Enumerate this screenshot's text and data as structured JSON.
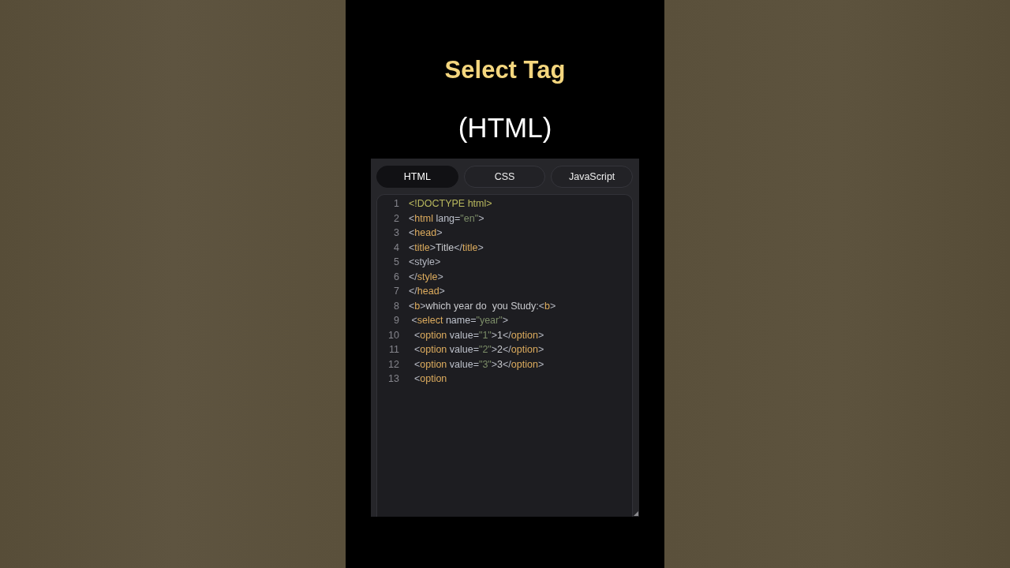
{
  "heading": {
    "title": "Select Tag",
    "subtitle": "(HTML)"
  },
  "tabs": [
    {
      "label": "HTML",
      "selected": true
    },
    {
      "label": "CSS",
      "selected": false
    },
    {
      "label": "JavaScript",
      "selected": false
    }
  ],
  "code_lines": [
    {
      "number": "1",
      "tokens": [
        {
          "kind": "doctype",
          "text": "<!DOCTYPE html>"
        }
      ]
    },
    {
      "number": "2",
      "tokens": [
        {
          "kind": "punct",
          "text": "<"
        },
        {
          "kind": "tag",
          "text": "html"
        },
        {
          "kind": "attr",
          "text": " lang="
        },
        {
          "kind": "string",
          "text": "\"en\""
        },
        {
          "kind": "punct",
          "text": ">"
        }
      ]
    },
    {
      "number": "3",
      "tokens": [
        {
          "kind": "punct",
          "text": "<"
        },
        {
          "kind": "tag",
          "text": "head"
        },
        {
          "kind": "punct",
          "text": ">"
        }
      ]
    },
    {
      "number": "4",
      "tokens": [
        {
          "kind": "punct",
          "text": "<"
        },
        {
          "kind": "tag",
          "text": "title"
        },
        {
          "kind": "punct",
          "text": ">"
        },
        {
          "kind": "text",
          "text": "Title"
        },
        {
          "kind": "punct",
          "text": "</"
        },
        {
          "kind": "tag",
          "text": "title"
        },
        {
          "kind": "punct",
          "text": ">"
        }
      ]
    },
    {
      "number": "5",
      "tokens": [
        {
          "kind": "punct",
          "text": "<style>"
        }
      ]
    },
    {
      "number": "6",
      "tokens": [
        {
          "kind": "punct",
          "text": "</"
        },
        {
          "kind": "tag",
          "text": "style"
        },
        {
          "kind": "punct",
          "text": ">"
        }
      ]
    },
    {
      "number": "7",
      "tokens": [
        {
          "kind": "punct",
          "text": "</"
        },
        {
          "kind": "tag",
          "text": "head"
        },
        {
          "kind": "punct",
          "text": ">"
        }
      ]
    },
    {
      "number": "8",
      "tokens": [
        {
          "kind": "punct",
          "text": "<"
        },
        {
          "kind": "tag",
          "text": "b"
        },
        {
          "kind": "punct",
          "text": ">"
        },
        {
          "kind": "text",
          "text": "which year do  you Study:"
        },
        {
          "kind": "punct",
          "text": "<"
        },
        {
          "kind": "tag",
          "text": "b"
        },
        {
          "kind": "punct",
          "text": ">"
        }
      ]
    },
    {
      "number": "9",
      "tokens": [
        {
          "kind": "punct",
          "text": " <"
        },
        {
          "kind": "tag",
          "text": "select"
        },
        {
          "kind": "attr",
          "text": " name="
        },
        {
          "kind": "string",
          "text": "\"year\""
        },
        {
          "kind": "punct",
          "text": ">"
        }
      ]
    },
    {
      "number": "10",
      "tokens": [
        {
          "kind": "punct",
          "text": "  <"
        },
        {
          "kind": "tag",
          "text": "option"
        },
        {
          "kind": "attr",
          "text": " value="
        },
        {
          "kind": "string",
          "text": "\"1\""
        },
        {
          "kind": "punct",
          "text": ">"
        },
        {
          "kind": "text",
          "text": "1"
        },
        {
          "kind": "punct",
          "text": "</"
        },
        {
          "kind": "tag",
          "text": "option"
        },
        {
          "kind": "punct",
          "text": ">"
        }
      ]
    },
    {
      "number": "11",
      "tokens": [
        {
          "kind": "punct",
          "text": "  <"
        },
        {
          "kind": "tag",
          "text": "option"
        },
        {
          "kind": "attr",
          "text": " value="
        },
        {
          "kind": "string",
          "text": "\"2\""
        },
        {
          "kind": "punct",
          "text": ">"
        },
        {
          "kind": "text",
          "text": "2"
        },
        {
          "kind": "punct",
          "text": "</"
        },
        {
          "kind": "tag",
          "text": "option"
        },
        {
          "kind": "punct",
          "text": ">"
        }
      ]
    },
    {
      "number": "12",
      "tokens": [
        {
          "kind": "punct",
          "text": "  <"
        },
        {
          "kind": "tag",
          "text": "option"
        },
        {
          "kind": "attr",
          "text": " value="
        },
        {
          "kind": "string",
          "text": "\"3\""
        },
        {
          "kind": "punct",
          "text": ">"
        },
        {
          "kind": "text",
          "text": "3"
        },
        {
          "kind": "punct",
          "text": "</"
        },
        {
          "kind": "tag",
          "text": "option"
        },
        {
          "kind": "punct",
          "text": ">"
        }
      ]
    },
    {
      "number": "13",
      "tokens": [
        {
          "kind": "punct",
          "text": "  <"
        },
        {
          "kind": "tag",
          "text": "option"
        }
      ]
    }
  ]
}
